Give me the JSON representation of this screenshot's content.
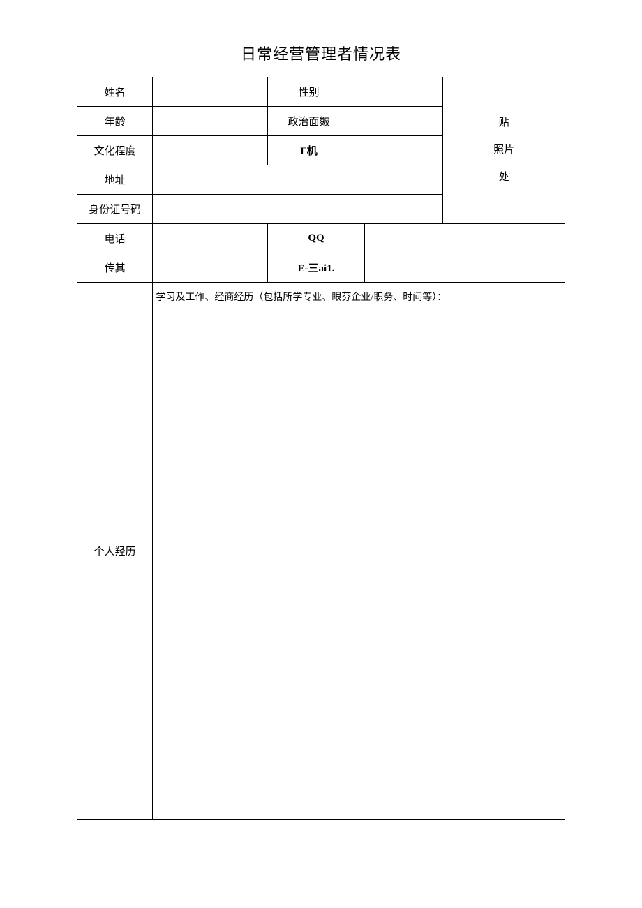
{
  "title": "日常经营管理者情况表",
  "labels": {
    "name": "姓名",
    "gender": "性别",
    "age": "年龄",
    "political": "政治面皴",
    "education": "文化程度",
    "mobile": "Γ机",
    "address": "地址",
    "idcard": "身份证号码",
    "phone": "电话",
    "qq": "QQ",
    "fax": "传其",
    "email": "E-三ai1.",
    "resume": "个人羟历"
  },
  "values": {
    "name": "",
    "gender": "",
    "age": "",
    "political": "",
    "education": "",
    "mobile": "",
    "address": "",
    "idcard": "",
    "phone": "",
    "qq": "",
    "fax": "",
    "email": "",
    "resume": ""
  },
  "photo": {
    "line1": "贴",
    "line2": "照片",
    "line3": "处"
  },
  "resume_prompt": "学习及工作、经商经历（包括所学专业、眼芬企业/职务、时间等）："
}
